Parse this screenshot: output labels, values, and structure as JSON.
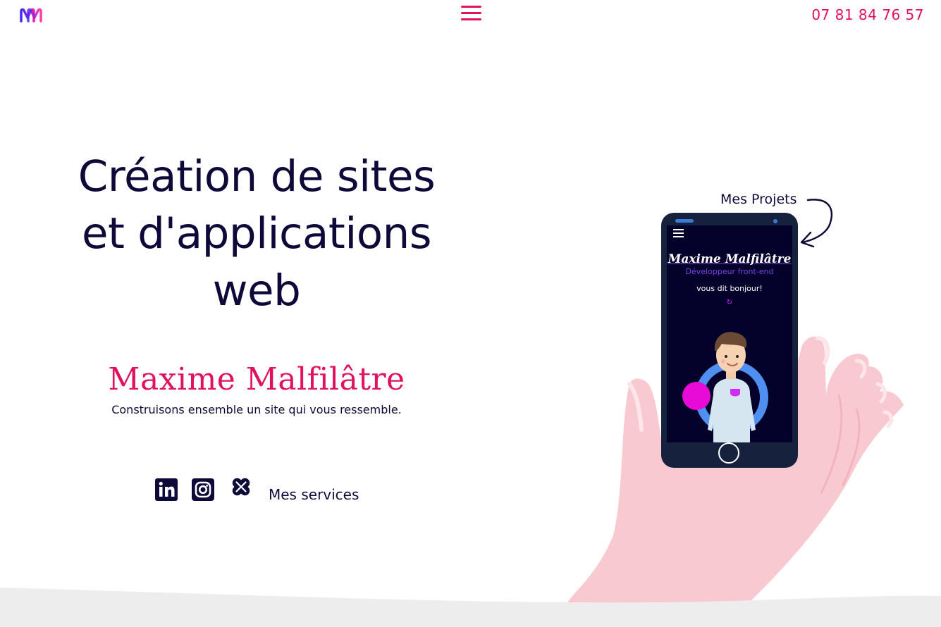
{
  "header": {
    "logo_alt": "M",
    "menu_icon": "hamburger-icon",
    "phone": "07 81 84 76 57"
  },
  "hero": {
    "title_line1": "Création de sites",
    "title_line2": "et d'applications",
    "title_line3": "web",
    "name": "Maxime Malfilâtre",
    "tagline": "Construisons ensemble un site qui vous ressemble."
  },
  "socials": {
    "icons": [
      "linkedin-icon",
      "instagram-icon",
      "malt-icon"
    ],
    "services_label": "Mes services"
  },
  "projects": {
    "label": "Mes Projets"
  },
  "phone_screen": {
    "name": "Maxime Malfilâtre",
    "role": "Développeur front-end",
    "greeting": "vous dit bonjour!",
    "refresh_icon": "↻"
  },
  "colors": {
    "accent": "#e0115f",
    "navy": "#0d0a3a",
    "hand": "#f8c9d0",
    "phone": "#16213e",
    "screen": "#04012a",
    "purple": "#7b3fe4",
    "magenta": "#e80ad6",
    "footer": "#ededed"
  }
}
